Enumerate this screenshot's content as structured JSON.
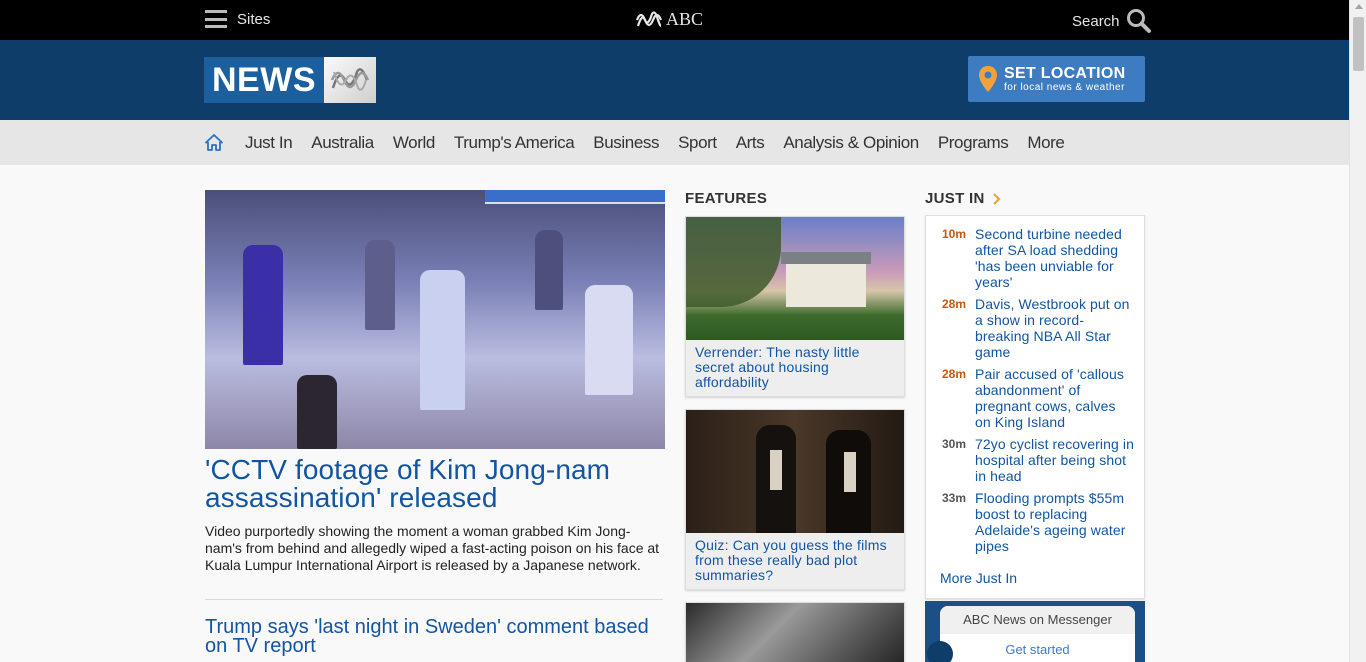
{
  "topbar": {
    "sites_label": "Sites",
    "brand": "ABC",
    "search_label": "Search"
  },
  "header": {
    "logo_text": "NEWS",
    "set_location": {
      "title": "SET LOCATION",
      "subtitle": "for local news & weather"
    }
  },
  "nav": {
    "items": [
      "Just In",
      "Australia",
      "World",
      "Trump's America",
      "Business",
      "Sport",
      "Arts",
      "Analysis & Opinion",
      "Programs",
      "More"
    ]
  },
  "lead": {
    "title": "'CCTV footage of Kim Jong-nam assassination' released",
    "description": "Video purportedly showing the moment a woman grabbed Kim Jong-nam's from behind and allegedly wiped a fast-acting poison on his face at Kuala Lumpur International Airport is released by a Japanese network.",
    "second_story": "Trump says 'last night in Sweden' comment based on TV report"
  },
  "features": {
    "heading": "FEATURES",
    "cards": [
      {
        "caption": "Verrender: The nasty little secret about housing affordability"
      },
      {
        "caption": "Quiz: Can you guess the films from these really bad plot summaries?"
      }
    ]
  },
  "justin": {
    "heading": "JUST IN",
    "items": [
      {
        "time": "10m",
        "text": "Second turbine needed after SA load shedding 'has been unviable for years'"
      },
      {
        "time": "28m",
        "text": "Davis, Westbrook put on a show in record-breaking NBA All Star game"
      },
      {
        "time": "28m",
        "text": "Pair accused of 'callous abandonment' of pregnant cows, calves on King Island"
      },
      {
        "time": "30m",
        "text": "72yo cyclist recovering in hospital after being shot in head"
      },
      {
        "time": "33m",
        "text": "Flooding prompts $55m boost to replacing Adelaide's ageing water pipes"
      }
    ],
    "more_label": "More Just In"
  },
  "messenger": {
    "title": "ABC News on Messenger",
    "button": "Get started"
  },
  "colors": {
    "topbar_bg": "#000000",
    "header_bg": "#0e3d6a",
    "link_blue": "#1155a3",
    "recent_time": "#c5580f",
    "location_button": "#3d7cc0"
  }
}
